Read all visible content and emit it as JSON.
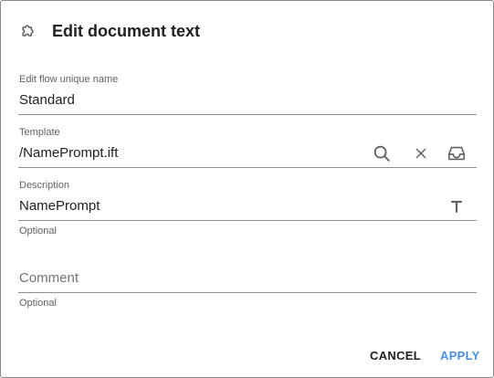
{
  "dialog": {
    "title": "Edit document text",
    "title_icon": "puzzle-icon"
  },
  "fields": {
    "unique_name": {
      "label": "Edit flow unique name",
      "value": "Standard"
    },
    "template": {
      "label": "Template",
      "value": "/NamePrompt.ift",
      "icons": [
        "search-icon",
        "clear-icon",
        "inbox-icon"
      ]
    },
    "description": {
      "label": "Description",
      "value": "NamePrompt",
      "hint": "Optional",
      "icon": "text-format-icon"
    },
    "comment": {
      "placeholder": "Comment",
      "hint": "Optional"
    }
  },
  "actions": {
    "cancel": "CANCEL",
    "apply": "APPLY"
  },
  "colors": {
    "accent": "#4a90e2",
    "text": "#202124",
    "muted": "#5f6368",
    "underline": "#8f8f8f"
  }
}
